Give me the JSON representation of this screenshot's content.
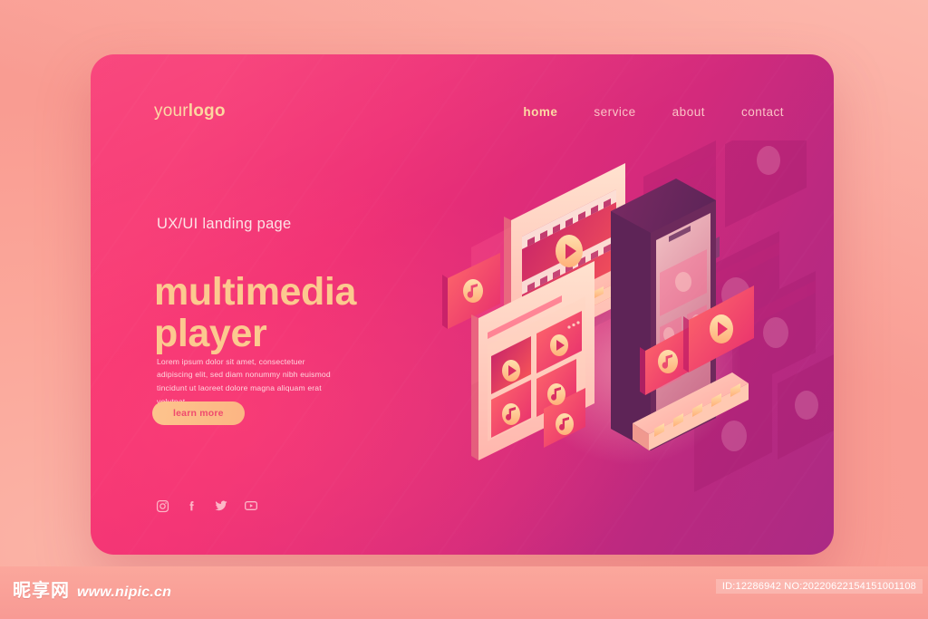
{
  "page": {
    "background_color": "#fbaa9f",
    "card_accent": "#ef2f75"
  },
  "hero": {
    "logo": {
      "prefix": "your",
      "strong": "logo"
    },
    "nav": {
      "items": [
        {
          "label": "home",
          "active": true
        },
        {
          "label": "service",
          "active": false
        },
        {
          "label": "about",
          "active": false
        },
        {
          "label": "contact",
          "active": false
        }
      ]
    },
    "eyebrow": "UX/UI landing page",
    "title_line1": "multimedia",
    "title_line2": "player",
    "paragraph": "Lorem ipsum dolor sit amet, consectetuer adipiscing elit, sed diam nonummy nibh euismod tincidunt ut laoreet dolore magna aliquam erat volutpat.",
    "cta_label": "learn more",
    "accent_text_color": "#fcc98f",
    "social": [
      {
        "name": "instagram-icon"
      },
      {
        "name": "facebook-icon"
      },
      {
        "name": "twitter-icon"
      },
      {
        "name": "youtube-icon"
      }
    ]
  },
  "illustration": {
    "name": "isometric-multimedia-player-illustration",
    "elements": [
      "background-ghost-video-panels",
      "video-player-window-filmstrip",
      "smartphone-device",
      "media-thumbnail-grid-window",
      "floating-music-card-left",
      "floating-music-card-right",
      "floating-play-card-right",
      "media-control-bar-upper",
      "media-control-bar-lower"
    ]
  },
  "watermark": {
    "site_cn": "昵享网",
    "site_url": "www.nipic.cn",
    "id_text": "ID:12286942 NO:20220622154151001108"
  }
}
